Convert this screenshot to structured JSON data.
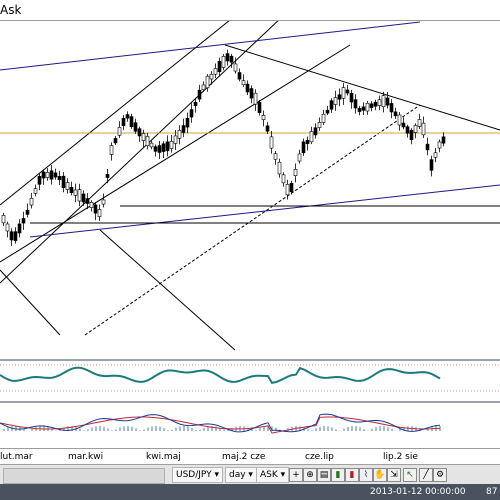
{
  "window": {
    "title": "Ask"
  },
  "xaxis": {
    "labels": [
      "lut.mar",
      "mar.kwi",
      "kwi.maj",
      "maj.2 cze",
      "cze.lip",
      "lip.2 sie"
    ]
  },
  "toolbar": {
    "symbol": "USD/JPY",
    "timeframe": "day",
    "price_side": "ASK",
    "icons": [
      "expand-icon",
      "crosshair-icon",
      "zoom-icon",
      "bar-chart-icon",
      "candle-chart-icon",
      "line-chart-icon",
      "pan-icon",
      "scroll-icon",
      "cursor-icon",
      "draw-line-icon",
      "settings-icon"
    ]
  },
  "statusbar": {
    "datetime": "2013-01-12 00:00:00",
    "value": "87"
  },
  "colors": {
    "candle_bull": "#ffffff",
    "candle_bear": "#000000",
    "channel": "#000000",
    "trendline_blue": "#1a1a8c",
    "horizontal_gold": "#c8a838",
    "oscillator": "#1b7a7a",
    "macd_signal": "#c02828",
    "macd_line": "#1a3a9a"
  }
}
